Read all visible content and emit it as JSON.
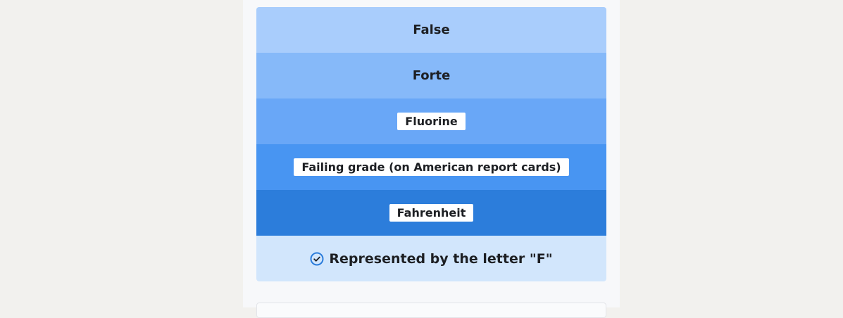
{
  "tiles": [
    {
      "label": "False",
      "color": "#a9cdfc",
      "chip": false
    },
    {
      "label": "Forte",
      "color": "#86b9f9",
      "chip": false
    },
    {
      "label": "Fluorine",
      "color": "#69a7f7",
      "chip": true
    },
    {
      "label": "Failing grade (on American report cards)",
      "color": "#4895f2",
      "chip": true
    },
    {
      "label": "Fahrenheit",
      "color": "#2c7ddb",
      "chip": true
    }
  ],
  "answer": {
    "label": "Represented by the letter \"F\"",
    "color": "#d2e6fc",
    "icon": "check-circle-icon",
    "icon_color": "#2c7ddb"
  }
}
